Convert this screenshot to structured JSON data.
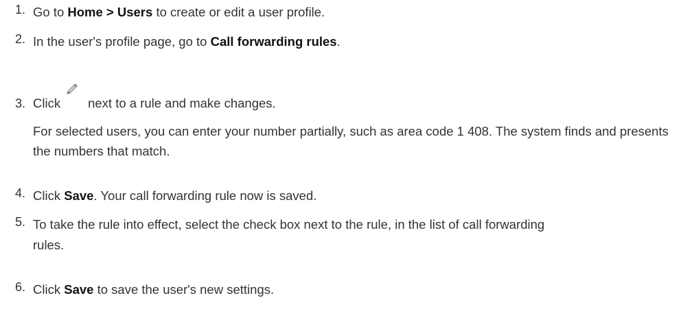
{
  "steps": [
    {
      "number": "1.",
      "segments": [
        {
          "text": "Go to ",
          "bold": false
        },
        {
          "text": "Home > Users",
          "bold": true
        },
        {
          "text": " to create or edit a user profile.",
          "bold": false
        }
      ]
    },
    {
      "number": "2.",
      "segments": [
        {
          "text": "In the user's profile page, go to ",
          "bold": false
        },
        {
          "text": "Call forwarding rules",
          "bold": true
        },
        {
          "text": ".",
          "bold": false
        }
      ]
    },
    {
      "number": "3.",
      "before_icon": "Click",
      "icon": "pencil-icon",
      "after_icon": "next to a rule and make changes.",
      "note": "For selected users, you can enter your number partially, such as area code 1 408. The system finds and presents the numbers that match."
    },
    {
      "number": "4.",
      "segments": [
        {
          "text": "Click ",
          "bold": false
        },
        {
          "text": "Save",
          "bold": true
        },
        {
          "text": ". Your call forwarding rule now is saved.",
          "bold": false
        }
      ]
    },
    {
      "number": "5.",
      "segments": [
        {
          "text": "To take the rule into effect, select the check box next to the rule, in the list of call forwarding rules.",
          "bold": false
        }
      ]
    },
    {
      "number": "6.",
      "segments": [
        {
          "text": "Click ",
          "bold": false
        },
        {
          "text": "Save",
          "bold": true
        },
        {
          "text": " to save the user's new settings.",
          "bold": false
        }
      ]
    }
  ]
}
